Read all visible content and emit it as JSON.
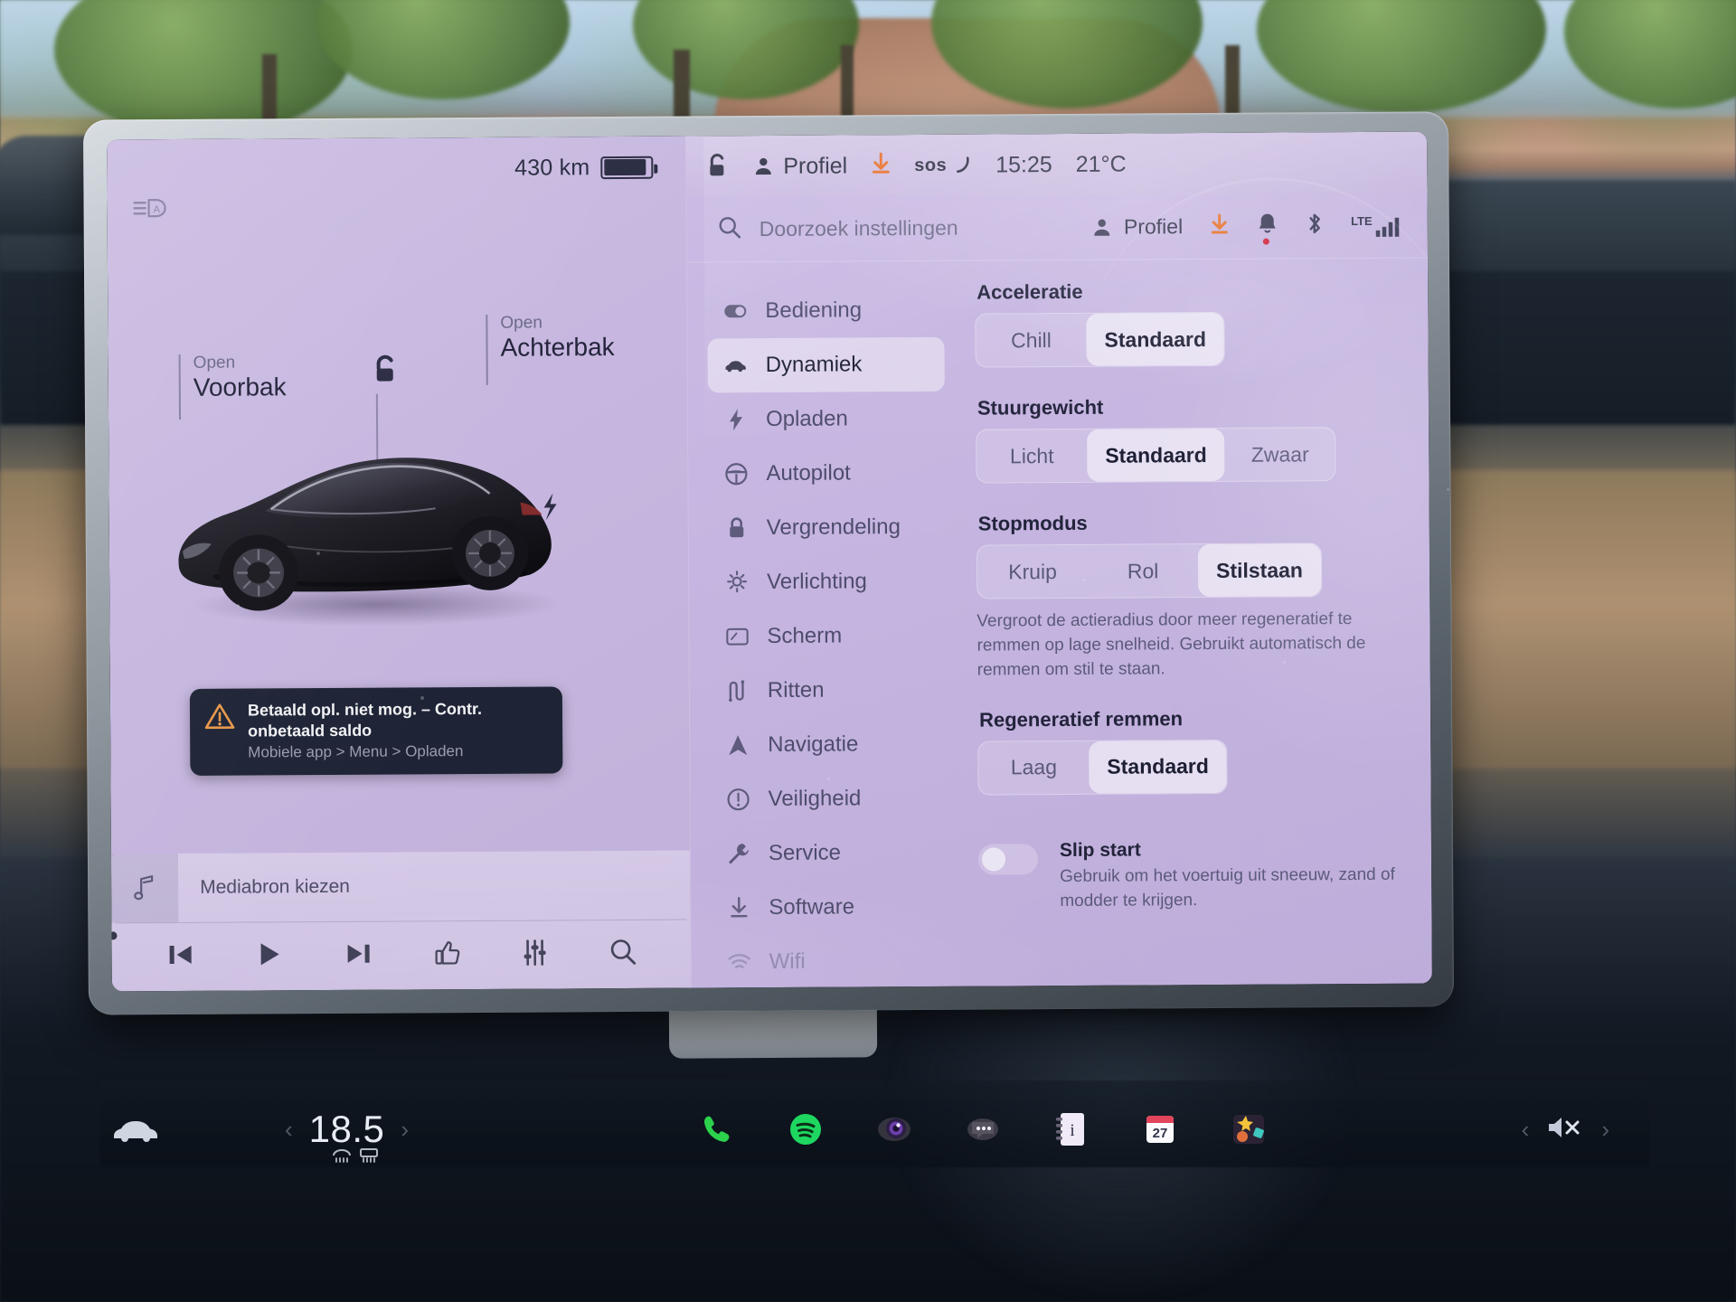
{
  "statusbar": {
    "range": "430 km",
    "battery_icon": "battery-icon",
    "lock_icon": "unlock-icon",
    "profile_label": "Profiel",
    "download_icon": "download-icon",
    "sos_label": "sos",
    "clock": "15:25",
    "outside_temp": "21°C"
  },
  "left_panel": {
    "headlight_icon": "auto-headlight-icon",
    "front_trunk": {
      "action": "Open",
      "name": "Voorbak"
    },
    "rear_trunk": {
      "action": "Open",
      "name": "Achterbak"
    },
    "lock_icon": "unlock-icon",
    "charge_port_icon": "charge-bolt-icon",
    "notification": {
      "icon": "warning-triangle-icon",
      "title": "Betaald opl. niet mog. – Contr. onbetaald saldo",
      "subtitle": "Mobiele app > Menu > Opladen"
    },
    "media": {
      "art_icon": "music-note-icon",
      "source_label": "Mediabron kiezen",
      "controls": [
        {
          "name": "previous-track-button",
          "icon": "skip-back-icon"
        },
        {
          "name": "play-button",
          "icon": "play-icon"
        },
        {
          "name": "next-track-button",
          "icon": "skip-forward-icon"
        },
        {
          "name": "thumbs-up-button",
          "icon": "thumbs-up-icon"
        },
        {
          "name": "equalizer-button",
          "icon": "sliders-icon"
        },
        {
          "name": "media-search-button",
          "icon": "search-icon"
        }
      ]
    }
  },
  "settings": {
    "search": {
      "icon": "search-icon",
      "placeholder": "Doorzoek instellingen"
    },
    "header_right": {
      "profile_label": "Profiel",
      "download_icon": "download-icon",
      "bell_icon": "bell-icon",
      "bluetooth_icon": "bluetooth-icon",
      "network_label": "LTE",
      "signal_icon": "signal-bars-icon"
    },
    "menu": [
      {
        "label": "Bediening",
        "icon": "toggle-icon",
        "active": false
      },
      {
        "label": "Dynamiek",
        "icon": "car-icon",
        "active": true
      },
      {
        "label": "Opladen",
        "icon": "bolt-icon",
        "active": false
      },
      {
        "label": "Autopilot",
        "icon": "steering-wheel-icon",
        "active": false
      },
      {
        "label": "Vergrendeling",
        "icon": "lock-icon",
        "active": false
      },
      {
        "label": "Verlichting",
        "icon": "sun-icon",
        "active": false
      },
      {
        "label": "Scherm",
        "icon": "display-icon",
        "active": false
      },
      {
        "label": "Ritten",
        "icon": "trip-icon",
        "active": false
      },
      {
        "label": "Navigatie",
        "icon": "navigation-arrow-icon",
        "active": false
      },
      {
        "label": "Veiligheid",
        "icon": "alert-circle-icon",
        "active": false
      },
      {
        "label": "Service",
        "icon": "wrench-icon",
        "active": false
      },
      {
        "label": "Software",
        "icon": "download-icon",
        "active": false
      },
      {
        "label": "Wifi",
        "icon": "wifi-icon",
        "active": false
      }
    ],
    "sections": {
      "acceleration": {
        "title": "Acceleratie",
        "options": [
          "Chill",
          "Standaard"
        ],
        "selected": "Standaard"
      },
      "steering": {
        "title": "Stuurgewicht",
        "options": [
          "Licht",
          "Standaard",
          "Zwaar"
        ],
        "selected": "Standaard"
      },
      "stopping_mode": {
        "title": "Stopmodus",
        "options": [
          "Kruip",
          "Rol",
          "Stilstaan"
        ],
        "selected": "Stilstaan",
        "description": "Vergroot de actieradius door meer regeneratief te remmen op lage snelheid. Gebruikt automatisch de remmen om stil te staan."
      },
      "regen_braking": {
        "title": "Regeneratief remmen",
        "options": [
          "Laag",
          "Standaard"
        ],
        "selected": "Standaard"
      },
      "slip_start": {
        "title": "Slip start",
        "description": "Gebruik om het voertuig uit sneeuw, zand of modder te krijgen.",
        "enabled": false
      }
    }
  },
  "taskbar": {
    "car_icon": "car-front-icon",
    "prev_chevron": "chevron-left-icon",
    "next_chevron": "chevron-right-icon",
    "temperature": "18.5",
    "defrost_icons": [
      "front-defrost-icon",
      "rear-defrost-icon"
    ],
    "apps": [
      {
        "name": "phone-app-icon",
        "label": "Telefoon"
      },
      {
        "name": "spotify-app-icon",
        "label": "Spotify"
      },
      {
        "name": "camera-app-icon",
        "label": "Camera"
      },
      {
        "name": "messages-app-icon",
        "label": "Berichten"
      },
      {
        "name": "manual-app-icon",
        "label": "Handleiding"
      },
      {
        "name": "calendar-app-icon",
        "label": "27"
      },
      {
        "name": "toybox-app-icon",
        "label": "Toybox"
      }
    ],
    "volume_icon": "volume-muted-icon"
  },
  "colors": {
    "accent_orange": "#e8702a",
    "notif_bg": "#1e2436",
    "screen_tint": "#c7b7e0",
    "text_dark": "#23243a",
    "alert_red": "#d0243a"
  }
}
